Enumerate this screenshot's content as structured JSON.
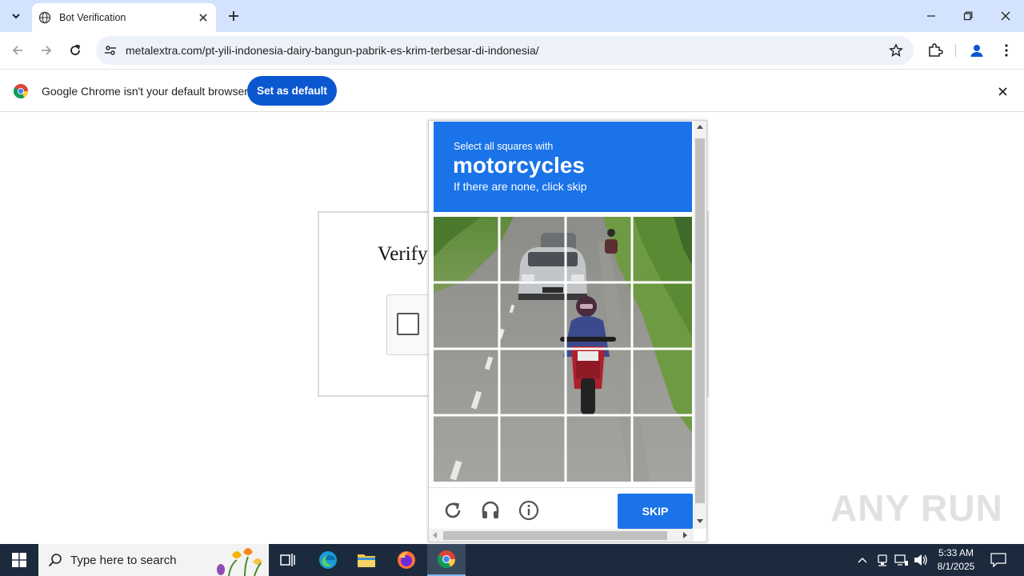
{
  "browser": {
    "tab_title": "Bot Verification",
    "url": "metalextra.com/pt-yili-indonesia-dairy-bangun-pabrik-es-krim-terbesar-di-indonesia/",
    "infobar_text": "Google Chrome isn't your default browser",
    "set_default_label": "Set as default"
  },
  "page": {
    "verify_title": "Verify"
  },
  "captcha": {
    "instruction_small": "Select all squares with",
    "target_word": "motorcycles",
    "hint": "If there are none, click skip",
    "skip_label": "SKIP",
    "header_color": "#1a73e8",
    "grid_rows": 4,
    "grid_cols": 4
  },
  "watermark": "ANY RUN",
  "taskbar": {
    "search_placeholder": "Type here to search",
    "time": "5:33 AM",
    "date": "8/1/2025"
  }
}
